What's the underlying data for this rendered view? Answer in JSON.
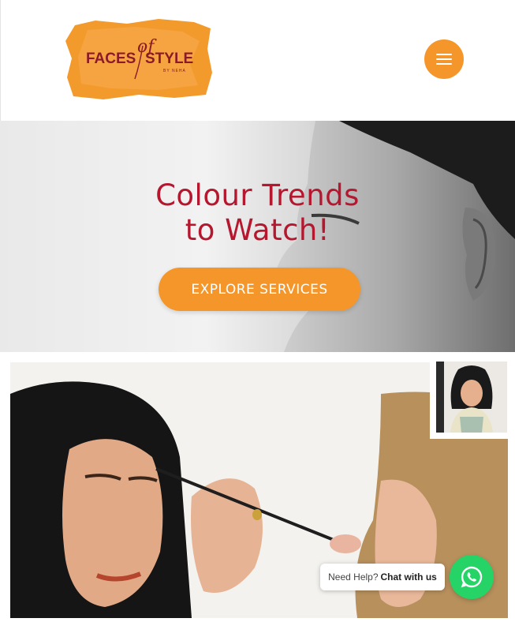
{
  "colors": {
    "accent_orange": "#f5962a",
    "brand_red": "#b5172f",
    "whatsapp_green": "#25d366"
  },
  "header": {
    "logo": {
      "word1": "FACES",
      "script": "of",
      "word2": "STYLE",
      "tagline": "BY NEHA"
    },
    "menu_icon": "hamburger-menu-icon"
  },
  "hero": {
    "title_line1": "Colour Trends",
    "title_line2": "to Watch!",
    "cta_label": "EXPLORE SERVICES"
  },
  "chat": {
    "help_text": "Need Help?",
    "cta_text": "Chat with us",
    "icon": "whatsapp-icon"
  }
}
